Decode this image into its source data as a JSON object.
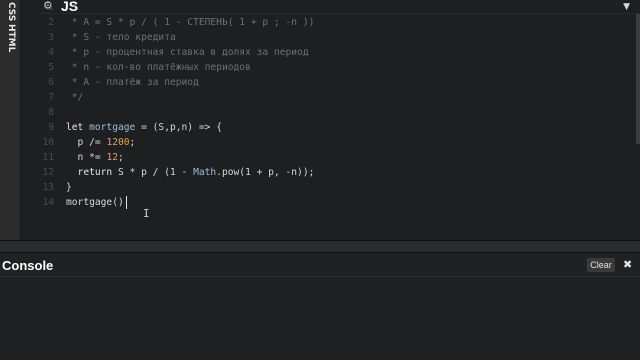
{
  "side_tabs": [
    "CSS",
    "HTML"
  ],
  "js_panel": {
    "title": "JS",
    "gear_icon": "gear-icon",
    "collapse_icon": "chevron-down-icon"
  },
  "code_lines": [
    {
      "n": "1",
      "tokens": [
        {
          "c": "cm",
          "t": " *"
        }
      ]
    },
    {
      "n": "2",
      "tokens": [
        {
          "c": "cm",
          "t": " * A = S * p / ( 1 - СТЕПЕНЬ( 1 + p ; -n ))"
        }
      ]
    },
    {
      "n": "3",
      "tokens": [
        {
          "c": "cm",
          "t": " * S - тело кредита"
        }
      ]
    },
    {
      "n": "4",
      "tokens": [
        {
          "c": "cm",
          "t": " * p - процентная ставка в долях за период"
        }
      ]
    },
    {
      "n": "5",
      "tokens": [
        {
          "c": "cm",
          "t": " * n - кол-во платёжных периодов"
        }
      ]
    },
    {
      "n": "6",
      "tokens": [
        {
          "c": "cm",
          "t": " * A - платёж за период"
        }
      ]
    },
    {
      "n": "7",
      "tokens": [
        {
          "c": "cm",
          "t": " */"
        }
      ]
    },
    {
      "n": "8",
      "tokens": []
    },
    {
      "n": "9",
      "tokens": [
        {
          "c": "kw",
          "t": "let "
        },
        {
          "c": "fn",
          "t": "mortgage"
        },
        {
          "c": "pl",
          "t": " = (S,p,n) => {"
        }
      ]
    },
    {
      "n": "10",
      "tokens": [
        {
          "c": "pl",
          "t": "  p /= "
        },
        {
          "c": "num",
          "t": "1200"
        },
        {
          "c": "pl",
          "t": ";"
        }
      ]
    },
    {
      "n": "11",
      "tokens": [
        {
          "c": "pl",
          "t": "  n *= "
        },
        {
          "c": "num",
          "t": "12"
        },
        {
          "c": "pl",
          "t": ";"
        }
      ]
    },
    {
      "n": "12",
      "tokens": [
        {
          "c": "kw",
          "t": "  return "
        },
        {
          "c": "pl",
          "t": "S * p / (1 - "
        },
        {
          "c": "prop",
          "t": "Math"
        },
        {
          "c": "pl",
          "t": ".pow(1 + p, -n));"
        }
      ]
    },
    {
      "n": "13",
      "tokens": [
        {
          "c": "pl",
          "t": "}"
        }
      ]
    },
    {
      "n": "14",
      "tokens": [
        {
          "c": "pl",
          "t": "mortgage()"
        }
      ]
    }
  ],
  "console": {
    "title": "Console",
    "clear_label": "Clear",
    "close_icon": "close-icon",
    "close_glyph": "✖"
  },
  "colors": {
    "background": "#1d1f20",
    "comment": "#707070",
    "number": "#e0a55a",
    "identifier": "#9fbeda"
  }
}
